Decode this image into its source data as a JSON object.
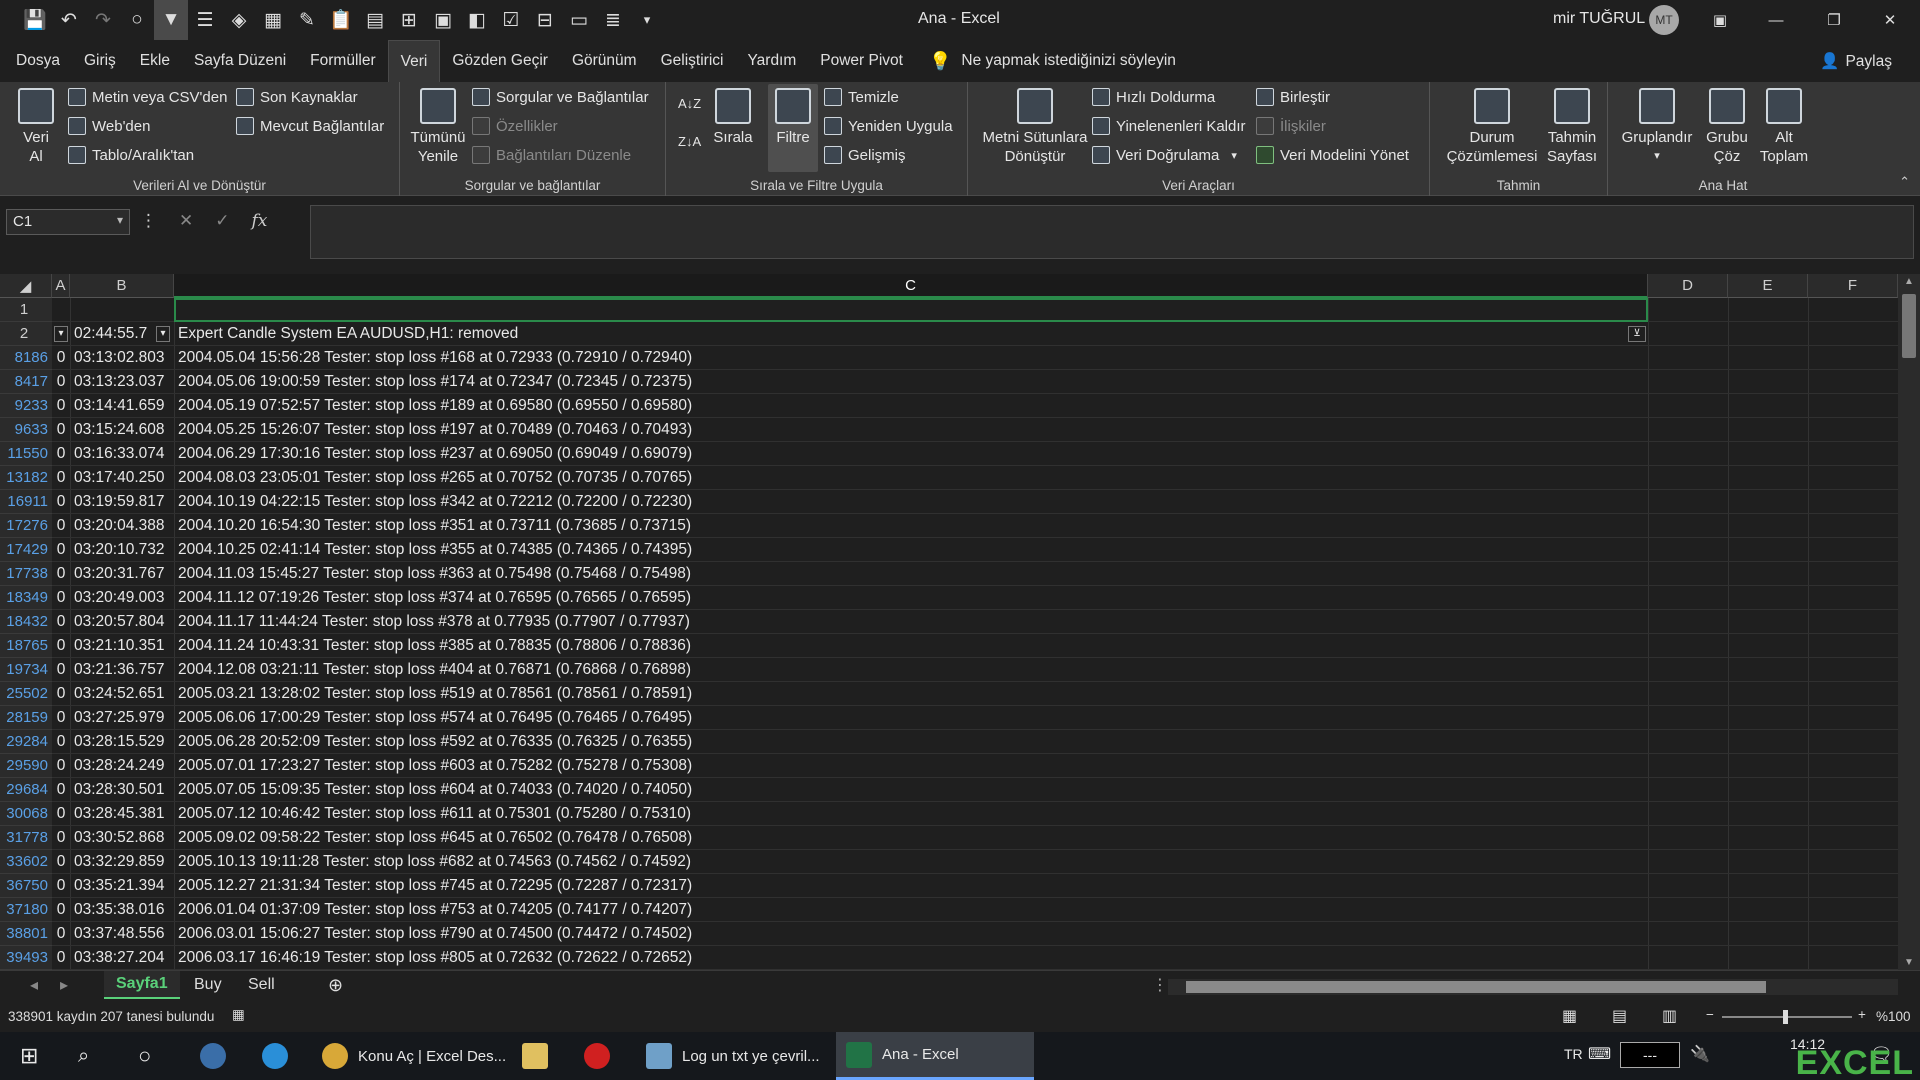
{
  "window": {
    "title": "Ana  -  Excel",
    "user_name": "mir TUĞRUL",
    "user_initials": "MT"
  },
  "menu": {
    "items": [
      "Dosya",
      "Giriş",
      "Ekle",
      "Sayfa Düzeni",
      "Formüller",
      "Veri",
      "Gözden Geçir",
      "Görünüm",
      "Geliştirici",
      "Yardım",
      "Power Pivot"
    ],
    "active": "Veri",
    "tell_me": "Ne yapmak istediğinizi söyleyin",
    "share": "Paylaş"
  },
  "ribbon": {
    "g1": {
      "label": "Verileri Al ve Dönüştür",
      "big": "Veri\nAl",
      "btn1": "Metin veya CSV'den",
      "btn2": "Web'den",
      "btn3": "Tablo/Aralık'tan",
      "btn4": "Son Kaynaklar",
      "btn5": "Mevcut Bağlantılar"
    },
    "g2": {
      "label": "Sorgular ve bağlantılar",
      "big": "Tümünü\nYenile",
      "btn1": "Sorgular ve Bağlantılar",
      "btn2": "Özellikler",
      "btn3": "Bağlantıları Düzenle"
    },
    "g3": {
      "label": "Sırala ve Filtre Uygula",
      "sort": "Sırala",
      "filter": "Filtre",
      "clear": "Temizle",
      "reapply": "Yeniden Uygula",
      "advanced": "Gelişmiş"
    },
    "g4": {
      "label": "Veri Araçları",
      "big": "Metni Sütunlara\nDönüştür",
      "btn1": "Hızlı Doldurma",
      "btn2": "Yinelenenleri Kaldır",
      "btn3": "Veri Doğrulama",
      "btn4": "Birleştir",
      "btn5": "İlişkiler",
      "btn6": "Veri Modelini Yönet"
    },
    "g5": {
      "label": "Tahmin",
      "big1": "Durum\nÇözümlemesi",
      "big2": "Tahmin\nSayfası"
    },
    "g6": {
      "label": "Ana Hat",
      "big1": "Gruplandır",
      "big2": "Grubu\nÇöz",
      "big3": "Alt\nToplam"
    }
  },
  "formula_bar": {
    "name_box": "C1",
    "formula": ""
  },
  "columns": [
    "A",
    "B",
    "C",
    "D",
    "E",
    "F"
  ],
  "header_rows": [
    {
      "row": "1",
      "a": "",
      "b": "",
      "c": ""
    },
    {
      "row": "2",
      "a": "",
      "b": "02:44:55.7",
      "c": "Expert Candle System EA AUDUSD,H1: removed"
    }
  ],
  "rows": [
    {
      "row": "8186",
      "a": "0",
      "b": "03:13:02.803",
      "c": "2004.05.04 15:56:28  Tester: stop loss #168 at 0.72933 (0.72910 / 0.72940)"
    },
    {
      "row": "8417",
      "a": "0",
      "b": "03:13:23.037",
      "c": "2004.05.06 19:00:59  Tester: stop loss #174 at 0.72347 (0.72345 / 0.72375)"
    },
    {
      "row": "9233",
      "a": "0",
      "b": "03:14:41.659",
      "c": "2004.05.19 07:52:57  Tester: stop loss #189 at 0.69580 (0.69550 / 0.69580)"
    },
    {
      "row": "9633",
      "a": "0",
      "b": "03:15:24.608",
      "c": "2004.05.25 15:26:07  Tester: stop loss #197 at 0.70489 (0.70463 / 0.70493)"
    },
    {
      "row": "11550",
      "a": "0",
      "b": "03:16:33.074",
      "c": "2004.06.29 17:30:16  Tester: stop loss #237 at 0.69050 (0.69049 / 0.69079)"
    },
    {
      "row": "13182",
      "a": "0",
      "b": "03:17:40.250",
      "c": "2004.08.03 23:05:01  Tester: stop loss #265 at 0.70752 (0.70735 / 0.70765)"
    },
    {
      "row": "16911",
      "a": "0",
      "b": "03:19:59.817",
      "c": "2004.10.19 04:22:15  Tester: stop loss #342 at 0.72212 (0.72200 / 0.72230)"
    },
    {
      "row": "17276",
      "a": "0",
      "b": "03:20:04.388",
      "c": "2004.10.20 16:54:30  Tester: stop loss #351 at 0.73711 (0.73685 / 0.73715)"
    },
    {
      "row": "17429",
      "a": "0",
      "b": "03:20:10.732",
      "c": "2004.10.25 02:41:14  Tester: stop loss #355 at 0.74385 (0.74365 / 0.74395)"
    },
    {
      "row": "17738",
      "a": "0",
      "b": "03:20:31.767",
      "c": "2004.11.03 15:45:27  Tester: stop loss #363 at 0.75498 (0.75468 / 0.75498)"
    },
    {
      "row": "18349",
      "a": "0",
      "b": "03:20:49.003",
      "c": "2004.11.12 07:19:26  Tester: stop loss #374 at 0.76595 (0.76565 / 0.76595)"
    },
    {
      "row": "18432",
      "a": "0",
      "b": "03:20:57.804",
      "c": "2004.11.17 11:44:24  Tester: stop loss #378 at 0.77935 (0.77907 / 0.77937)"
    },
    {
      "row": "18765",
      "a": "0",
      "b": "03:21:10.351",
      "c": "2004.11.24 10:43:31  Tester: stop loss #385 at 0.78835 (0.78806 / 0.78836)"
    },
    {
      "row": "19734",
      "a": "0",
      "b": "03:21:36.757",
      "c": "2004.12.08 03:21:11  Tester: stop loss #404 at 0.76871 (0.76868 / 0.76898)"
    },
    {
      "row": "25502",
      "a": "0",
      "b": "03:24:52.651",
      "c": "2005.03.21 13:28:02  Tester: stop loss #519 at 0.78561 (0.78561 / 0.78591)"
    },
    {
      "row": "28159",
      "a": "0",
      "b": "03:27:25.979",
      "c": "2005.06.06 17:00:29  Tester: stop loss #574 at 0.76495 (0.76465 / 0.76495)"
    },
    {
      "row": "29284",
      "a": "0",
      "b": "03:28:15.529",
      "c": "2005.06.28 20:52:09  Tester: stop loss #592 at 0.76335 (0.76325 / 0.76355)"
    },
    {
      "row": "29590",
      "a": "0",
      "b": "03:28:24.249",
      "c": "2005.07.01 17:23:27  Tester: stop loss #603 at 0.75282 (0.75278 / 0.75308)"
    },
    {
      "row": "29684",
      "a": "0",
      "b": "03:28:30.501",
      "c": "2005.07.05 15:09:35  Tester: stop loss #604 at 0.74033 (0.74020 / 0.74050)"
    },
    {
      "row": "30068",
      "a": "0",
      "b": "03:28:45.381",
      "c": "2005.07.12 10:46:42  Tester: stop loss #611 at 0.75301 (0.75280 / 0.75310)"
    },
    {
      "row": "31778",
      "a": "0",
      "b": "03:30:52.868",
      "c": "2005.09.02 09:58:22  Tester: stop loss #645 at 0.76502 (0.76478 / 0.76508)"
    },
    {
      "row": "33602",
      "a": "0",
      "b": "03:32:29.859",
      "c": "2005.10.13 19:11:28  Tester: stop loss #682 at 0.74563 (0.74562 / 0.74592)"
    },
    {
      "row": "36750",
      "a": "0",
      "b": "03:35:21.394",
      "c": "2005.12.27 21:31:34  Tester: stop loss #745 at 0.72295 (0.72287 / 0.72317)"
    },
    {
      "row": "37180",
      "a": "0",
      "b": "03:35:38.016",
      "c": "2006.01.04 01:37:09  Tester: stop loss #753 at 0.74205 (0.74177 / 0.74207)"
    },
    {
      "row": "38801",
      "a": "0",
      "b": "03:37:48.556",
      "c": "2006.03.01 15:06:27  Tester: stop loss #790 at 0.74500 (0.74472 / 0.74502)"
    },
    {
      "row": "39493",
      "a": "0",
      "b": "03:38:27.204",
      "c": "2006.03.17 16:46:19  Tester: stop loss #805 at 0.72632 (0.72622 / 0.72652)"
    }
  ],
  "sheet_tabs": [
    "Sayfa1",
    "Buy",
    "Sell"
  ],
  "active_tab": "Sayfa1",
  "status": {
    "left": "338901 kaydın 207 tanesi bulundu",
    "zoom": "%100"
  },
  "taskbar": {
    "apps": [
      "Konu Aç | Excel Des...",
      "Log un txt ye çevril...",
      "Ana - Excel"
    ],
    "lang": "TR",
    "input": "---",
    "time": "14:12",
    "watermark": "EXCEL"
  },
  "colors": {
    "accent": "#217346",
    "filter_active": "#4f4f4f",
    "row_filtered": "#5aa0e6"
  }
}
